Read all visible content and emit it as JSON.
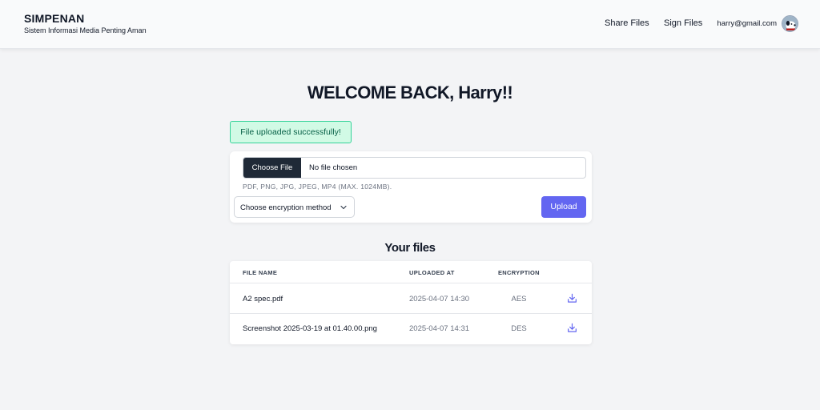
{
  "header": {
    "brand_title": "SIMPENAN",
    "brand_subtitle": "Sistem Informasi Media Penting Aman",
    "nav": [
      {
        "label": "Share Files"
      },
      {
        "label": "Sign Files"
      }
    ],
    "user_email": "harry@gmail.com",
    "avatar_icon": "user-avatar-icon"
  },
  "main": {
    "welcome": "WELCOME BACK, Harry!!",
    "alert": "File uploaded successfully!",
    "upload": {
      "choose_label": "Choose File",
      "file_status": "No file chosen",
      "hint": "PDF, PNG, JPG, JPEG, MP4 (MAX. 1024MB).",
      "encryption_selected": "Choose encryption method",
      "upload_label": "Upload"
    },
    "files_title": "Your files",
    "table": {
      "headers": [
        "FILE NAME",
        "UPLOADED AT",
        "ENCRYPTION"
      ],
      "rows": [
        {
          "name": "A2 spec.pdf",
          "uploaded_at": "2025-04-07 14:30",
          "encryption": "AES",
          "action_icon": "download-icon"
        },
        {
          "name": "Screenshot 2025-03-19 at 01.40.00.png",
          "uploaded_at": "2025-04-07 14:31",
          "encryption": "DES",
          "action_icon": "download-icon"
        }
      ]
    }
  },
  "colors": {
    "accent": "#6366f1",
    "dark_button": "#1f2937",
    "success_bg": "#d1fae5",
    "success_border": "#34d399",
    "page_bg": "#f3f4f6"
  }
}
